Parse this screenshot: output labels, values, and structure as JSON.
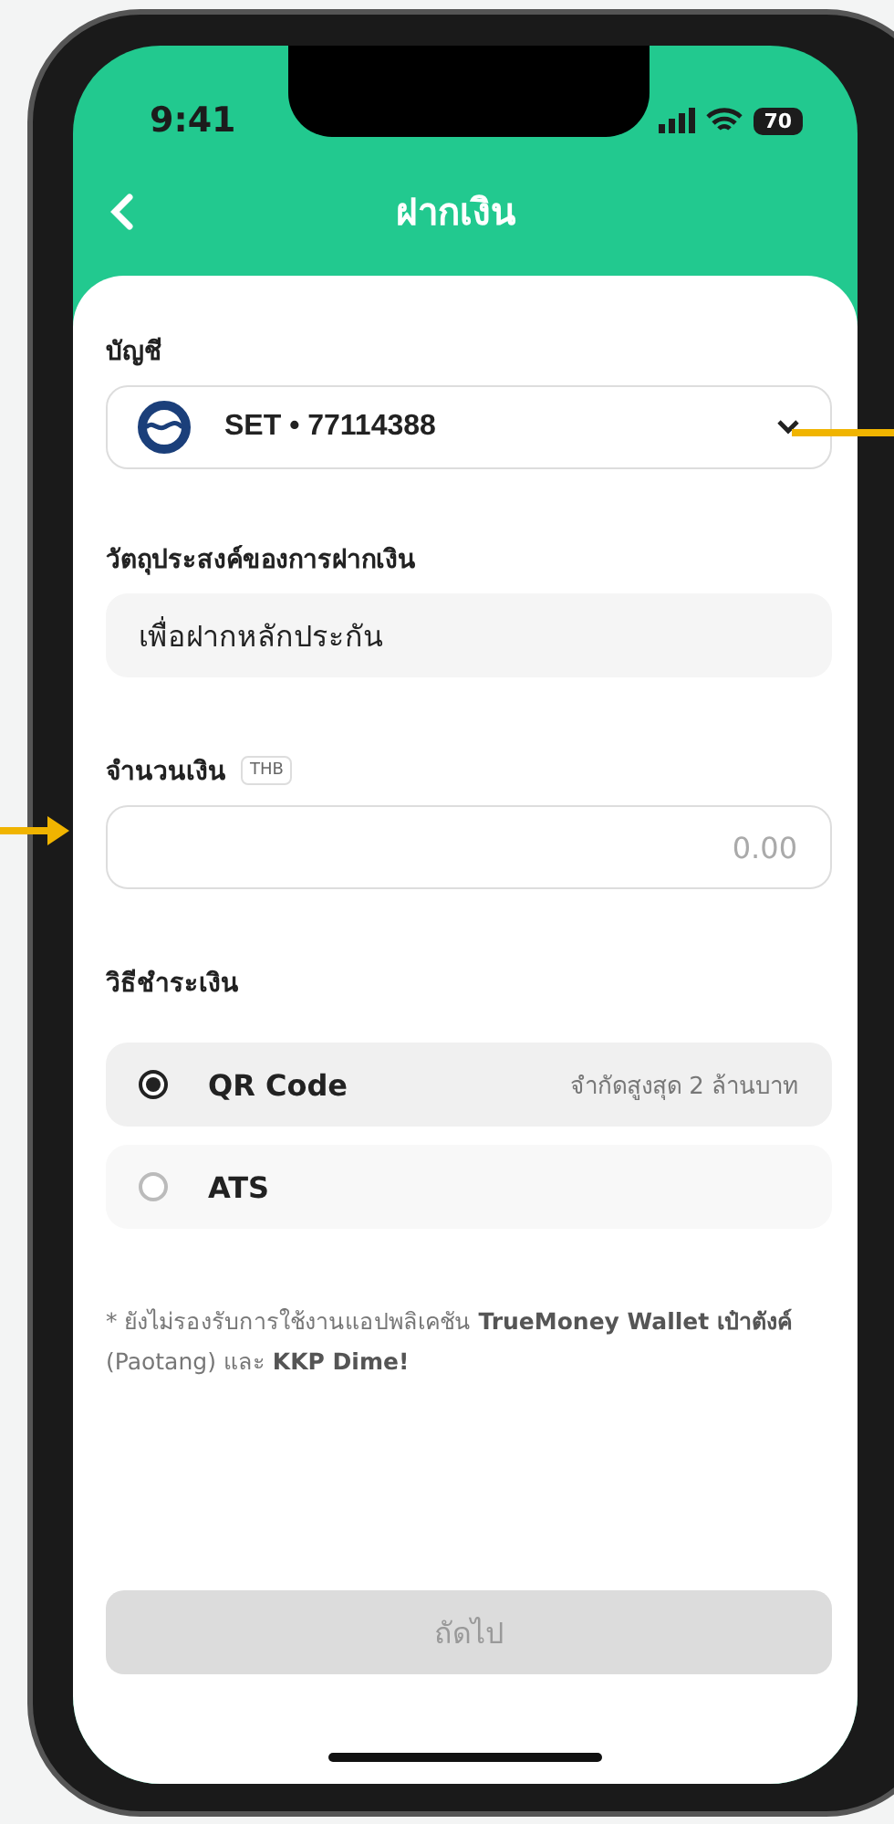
{
  "status_bar": {
    "time": "9:41",
    "battery": "70"
  },
  "header": {
    "title": "ฝากเงิน"
  },
  "account": {
    "label": "บัญชี",
    "value": "SET • 77114388"
  },
  "purpose": {
    "label": "วัตถุประสงค์ของการฝากเงิน",
    "value": "เพื่อฝากหลักประกัน"
  },
  "amount": {
    "label": "จำนวนเงิน",
    "currency": "THB",
    "placeholder": "0.00"
  },
  "payment": {
    "label": "วิธีชำระเงิน",
    "methods": [
      {
        "name": "QR Code",
        "note": "จำกัดสูงสุด 2 ล้านบาท",
        "selected": true
      },
      {
        "name": "ATS",
        "selected": false
      }
    ]
  },
  "footnote": "* ยังไม่รองรับการใช้งานแอปพลิเคชัน **TrueMoney Wallet เป๋าตังค์** (Paotang) และ **KKP Dime!**",
  "next_button": {
    "label": "ถัดไป",
    "disabled": true
  }
}
